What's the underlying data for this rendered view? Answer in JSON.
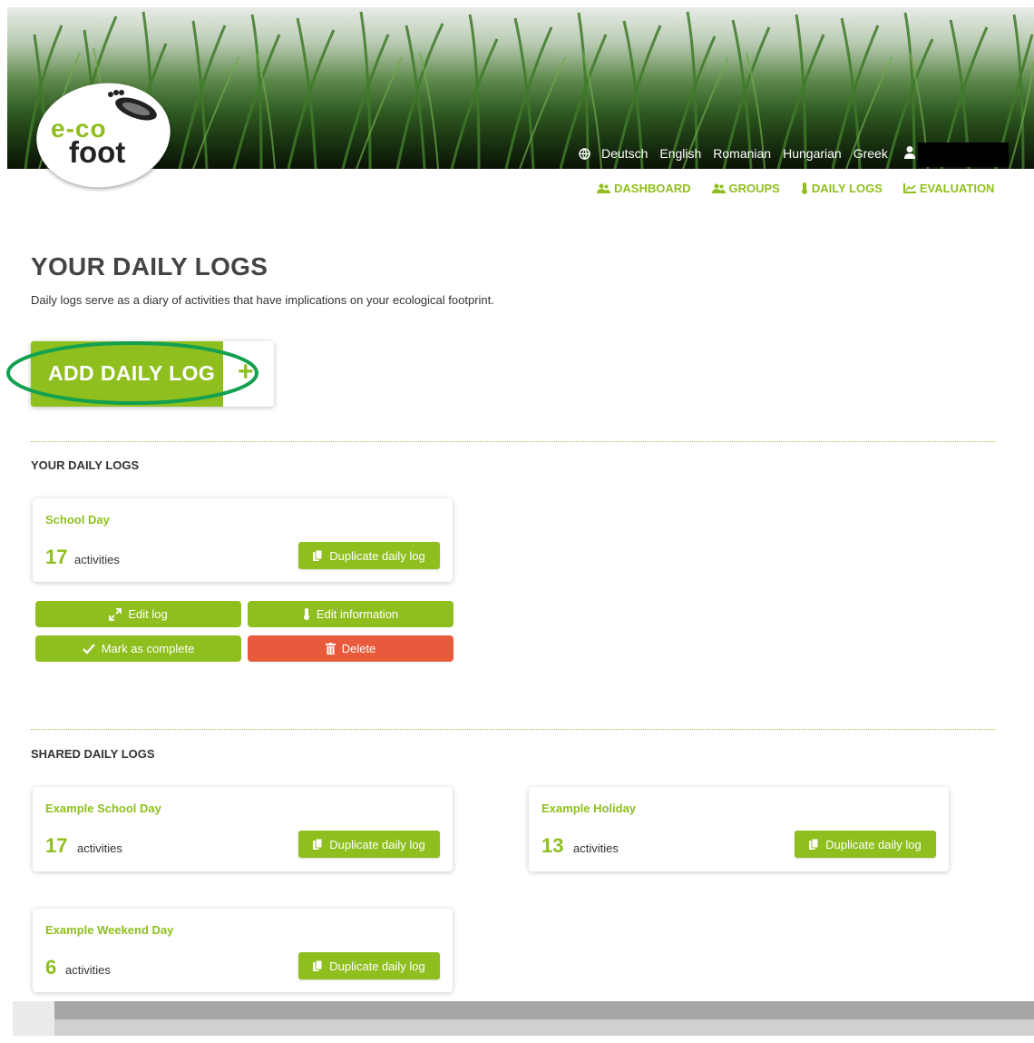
{
  "header": {
    "logo_e": "e-co",
    "logo_foot": "foot",
    "languages": [
      "Deutsch",
      "English",
      "Romanian",
      "Hungarian",
      "Greek"
    ]
  },
  "nav": {
    "dashboard": "DASHBOARD",
    "groups": "GROUPS",
    "daily_logs": "DAILY LOGS",
    "evaluation": "EVALUATION"
  },
  "page": {
    "title": "YOUR DAILY LOGS",
    "intro": "Daily logs serve as a diary of activities that have implications on your ecological footprint.",
    "add_button": "ADD DAILY LOG",
    "add_plus": "+"
  },
  "your_logs": {
    "heading": "YOUR DAILY LOGS",
    "items": [
      {
        "name": "School Day",
        "count": "17",
        "unit": "activities",
        "duplicate": "Duplicate daily log"
      }
    ],
    "actions": {
      "edit_log": "Edit log",
      "edit_information": "Edit information",
      "mark_complete": "Mark as complete",
      "delete": "Delete"
    }
  },
  "shared_logs": {
    "heading": "SHARED DAILY LOGS",
    "items": [
      {
        "name": "Example School Day",
        "count": "17",
        "unit": "activities",
        "duplicate": "Duplicate daily log"
      },
      {
        "name": "Example Holiday",
        "count": "13",
        "unit": "activities",
        "duplicate": "Duplicate daily log"
      },
      {
        "name": "Example Weekend Day",
        "count": "6",
        "unit": "activities",
        "duplicate": "Duplicate daily log"
      }
    ]
  },
  "colors": {
    "accent": "#8fbf1f",
    "danger": "#e85a3c",
    "highlight": "#13a050"
  }
}
